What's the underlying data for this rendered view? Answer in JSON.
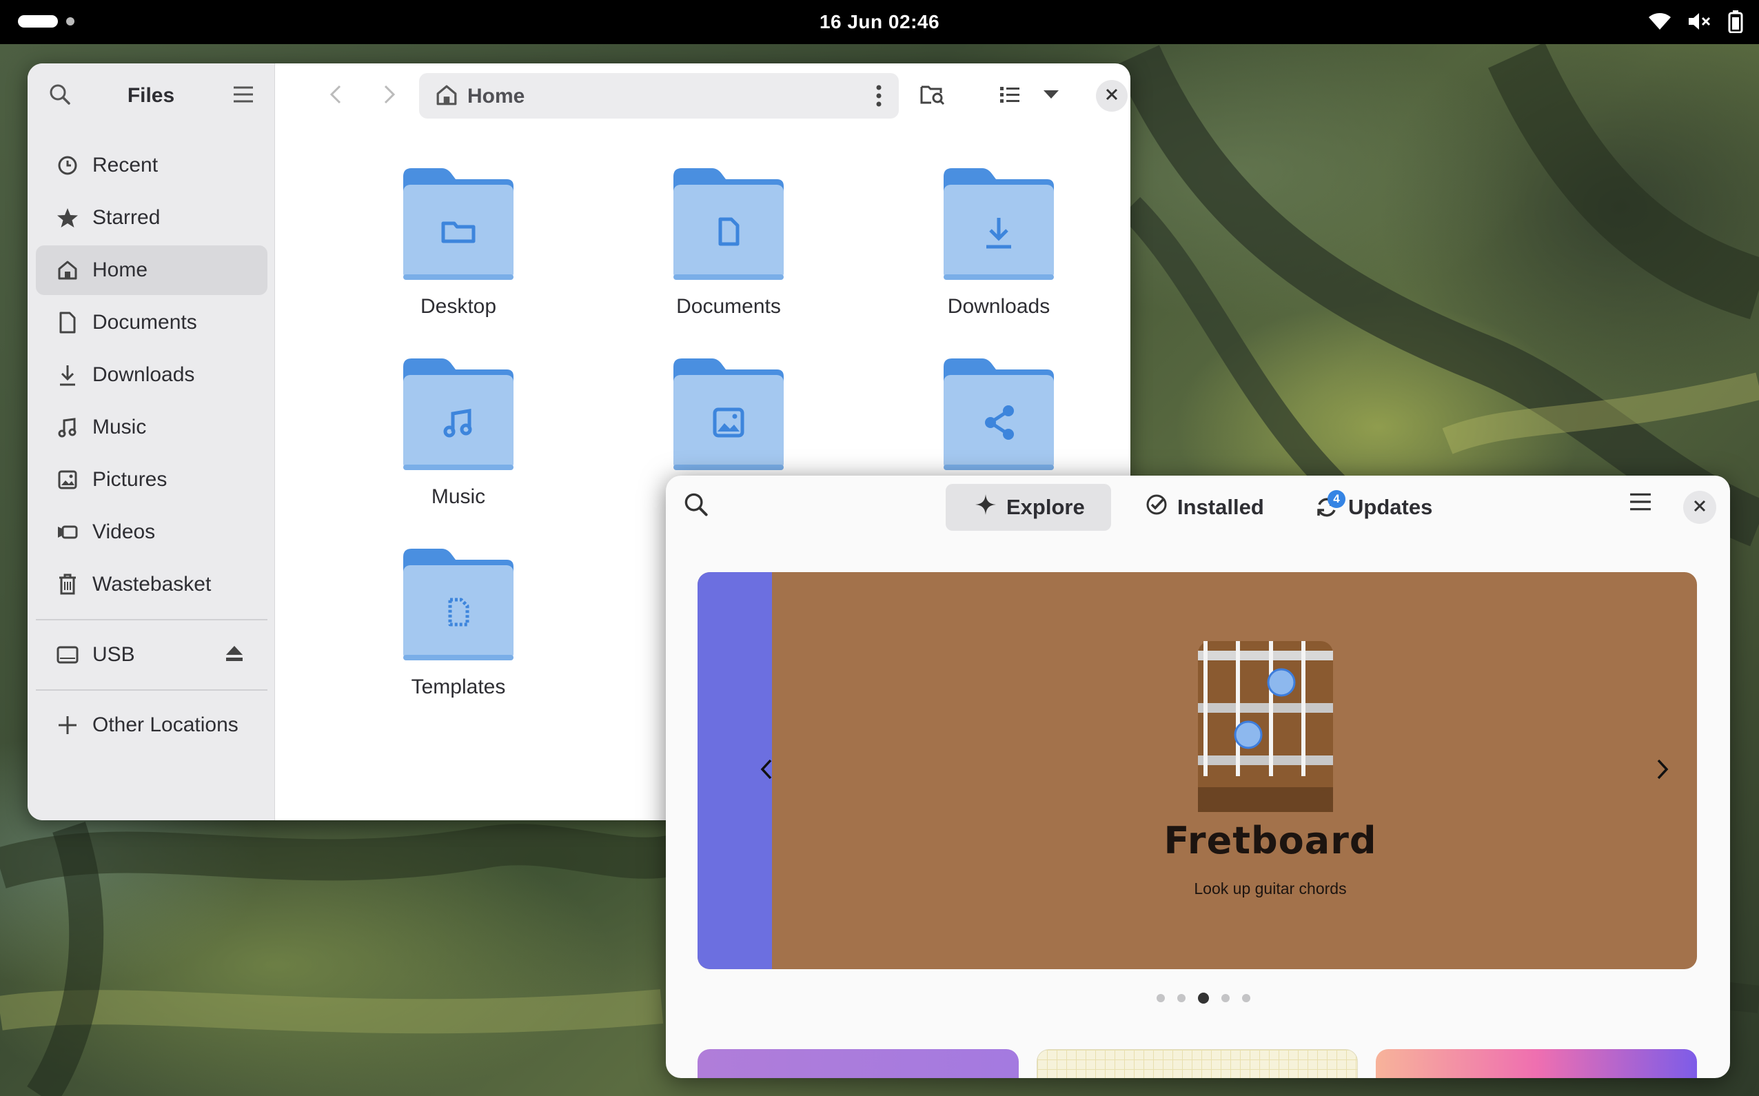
{
  "topbar": {
    "clock": "16 Jun  02:46",
    "icons": [
      "wifi-icon",
      "speaker-muted-icon",
      "battery-icon"
    ]
  },
  "files": {
    "title": "Files",
    "sidebar": {
      "items": [
        {
          "label": "Recent",
          "icon": "clock-icon"
        },
        {
          "label": "Starred",
          "icon": "star-icon"
        },
        {
          "label": "Home",
          "icon": "home-icon",
          "active": true
        },
        {
          "label": "Documents",
          "icon": "document-icon"
        },
        {
          "label": "Downloads",
          "icon": "download-icon"
        },
        {
          "label": "Music",
          "icon": "music-icon"
        },
        {
          "label": "Pictures",
          "icon": "picture-icon"
        },
        {
          "label": "Videos",
          "icon": "video-icon"
        },
        {
          "label": "Wastebasket",
          "icon": "trash-icon"
        }
      ],
      "devices": [
        {
          "label": "USB",
          "icon": "drive-icon",
          "action": "eject-icon"
        }
      ],
      "other": {
        "label": "Other Locations",
        "icon": "plus-icon"
      }
    },
    "path": {
      "label": "Home"
    },
    "folders": [
      {
        "label": "Desktop",
        "icon": "folder-desktop"
      },
      {
        "label": "Documents",
        "icon": "folder-documents"
      },
      {
        "label": "Downloads",
        "icon": "folder-downloads"
      },
      {
        "label": "Music",
        "icon": "folder-music"
      },
      {
        "label": "",
        "icon": "folder-pictures"
      },
      {
        "label": "",
        "icon": "folder-public-share"
      },
      {
        "label": "Templates",
        "icon": "folder-templates"
      },
      {
        "label": "",
        "icon": "folder-videos"
      }
    ],
    "colors": {
      "folder_light": "#a4c8f0",
      "folder_dark": "#4a8fe0",
      "sidebar_bg": "#ebebed"
    }
  },
  "software": {
    "tabs": [
      {
        "label": "Explore",
        "icon": "sparkle-icon",
        "active": true
      },
      {
        "label": "Installed",
        "icon": "check-circle-icon"
      },
      {
        "label": "Updates",
        "icon": "refresh-icon",
        "badge": "4"
      }
    ],
    "banner": {
      "app_name": "Fretboard",
      "app_summary": "Look up guitar chords",
      "bg_color": "#a3724b",
      "prev_color": "#6c6fe0",
      "page": 3,
      "pages": 5
    },
    "cards": [
      {
        "color": "#b27ddc"
      },
      {
        "color": "#f5f1d8"
      },
      {
        "color": "#f37aa6"
      }
    ]
  }
}
